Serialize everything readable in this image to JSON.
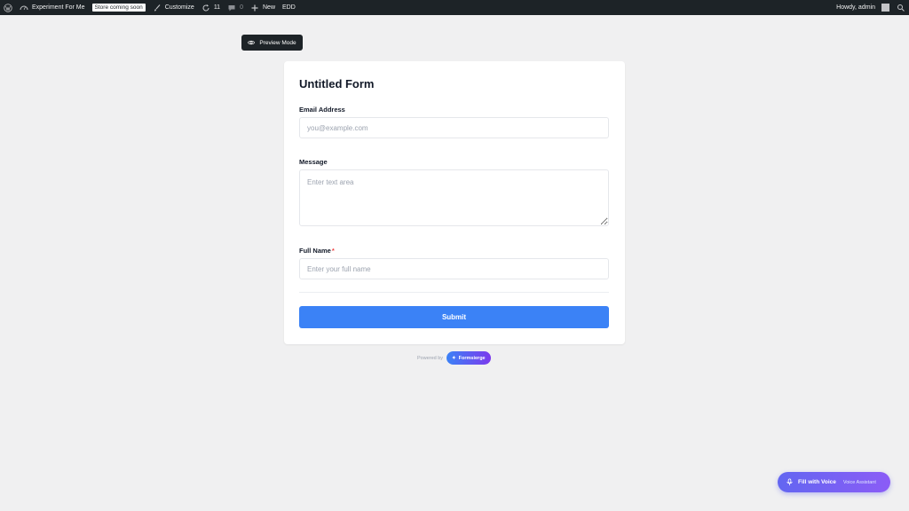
{
  "adminbar": {
    "site_name": "Experiment For Me",
    "store_badge": "Store coming soon",
    "customize": "Customize",
    "updates_count": "11",
    "comments_count": "0",
    "new_label": "New",
    "edd_label": "EDD",
    "howdy": "Howdy, admin"
  },
  "preview": {
    "label": "Preview Mode"
  },
  "form": {
    "title": "Untitled Form",
    "email": {
      "label": "Email Address",
      "placeholder": "you@example.com",
      "value": ""
    },
    "message": {
      "label": "Message",
      "placeholder": "Enter text area",
      "value": ""
    },
    "fullname": {
      "label": "Full Name",
      "required_mark": "*",
      "placeholder": "Enter your full name",
      "value": ""
    },
    "submit_label": "Submit"
  },
  "powered": {
    "text": "Powered by",
    "brand": "Formsierge"
  },
  "voice": {
    "label": "Fill with Voice",
    "sublabel": "Voice Assistant"
  },
  "colors": {
    "accent": "#3b82f6",
    "adminbar": "#1d2327",
    "required": "#ef4444"
  }
}
